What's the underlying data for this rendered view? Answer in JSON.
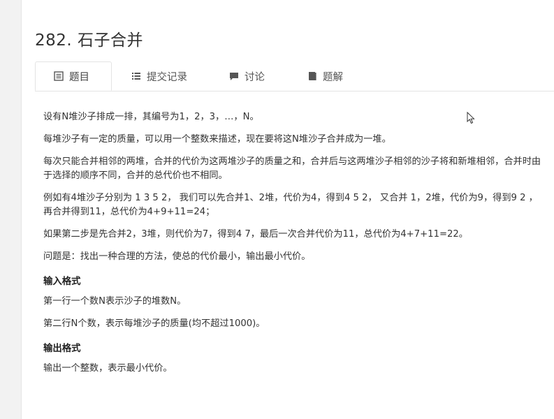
{
  "problem": {
    "title": "282. 石子合并"
  },
  "tabs": [
    {
      "label": "题目",
      "icon": "list-doc-icon"
    },
    {
      "label": "提交记录",
      "icon": "list-icon"
    },
    {
      "label": "讨论",
      "icon": "chat-icon"
    },
    {
      "label": "题解",
      "icon": "book-icon"
    }
  ],
  "description": {
    "p1": "设有N堆沙子排成一排，其编号为1，2，3，…，N。",
    "p2": "每堆沙子有一定的质量，可以用一个整数来描述，现在要将这N堆沙子合并成为一堆。",
    "p3": "每次只能合并相邻的两堆，合并的代价为这两堆沙子的质量之和，合并后与这两堆沙子相邻的沙子将和新堆相邻，合并时由于选择的顺序不同，合并的总代价也不相同。",
    "p4": "例如有4堆沙子分别为 1 3 5 2， 我们可以先合并1、2堆，代价为4，得到4 5 2， 又合并 1，2堆，代价为9，得到9 2 ，再合并得到11，总代价为4+9+11=24；",
    "p5": "如果第二步是先合并2，3堆，则代价为7，得到4 7，最后一次合并代价为11，总代价为4+7+11=22。",
    "p6": "问题是：找出一种合理的方法，使总的代价最小，输出最小代价。"
  },
  "input_format": {
    "heading": "输入格式",
    "line1": "第一行一个数N表示沙子的堆数N。",
    "line2": "第二行N个数，表示每堆沙子的质量(均不超过1000)。"
  },
  "output_format": {
    "heading": "输出格式",
    "line1": "输出一个整数，表示最小代价。"
  }
}
